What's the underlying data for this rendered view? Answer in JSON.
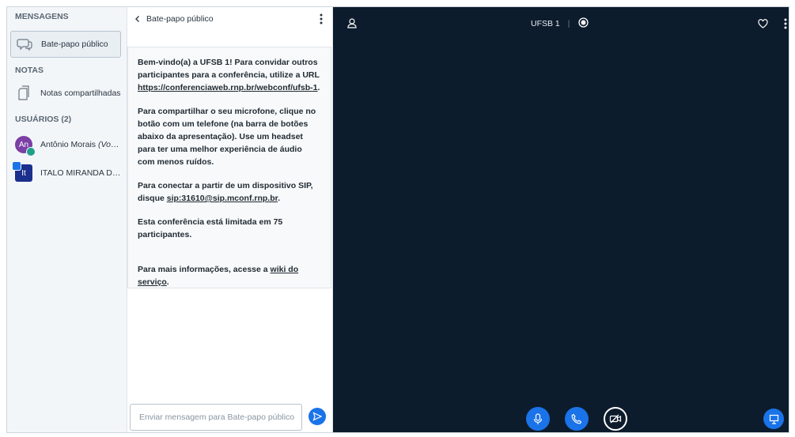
{
  "sidebar": {
    "messages_title": "MENSAGENS",
    "public_chat_label": "Bate-papo público",
    "notes_title": "NOTAS",
    "shared_notes_label": "Notas compartilhadas",
    "users_title": "USUÁRIOS (2)",
    "users": [
      {
        "initials": "An",
        "name": "Antônio Morais",
        "suffix": "(Você)",
        "color": "#7b3fa5"
      },
      {
        "initials": "It",
        "name": "ITALO MIRANDA DE ...",
        "suffix": "",
        "color": "#1b2f8c"
      }
    ]
  },
  "chat": {
    "header_title": "Bate-papo público",
    "welcome": {
      "p1_a": "Bem-vindo(a) a ",
      "p1_conf": "UFSB 1",
      "p1_b": "! Para convidar outros participantes para a conferência, utilize a URL ",
      "p1_url": "https://conferenciaweb.rnp.br/webconf/ufsb-1",
      "p1_end": ".",
      "p2": "Para compartilhar o seu microfone, clique no botão com um telefone (na barra de botões abaixo da apresentação). Use um headset para ter uma melhor experiência de áudio com menos ruídos.",
      "p3_a": "Para conectar a partir de um dispositivo SIP, disque ",
      "p3_sip": "sip:31610@sip.mconf.rnp.br",
      "p3_end": ".",
      "p4": "Esta conferência está limitada em 75 participantes.",
      "p5_a": "Para mais informações, acesse a ",
      "p5_link": "wiki do serviço",
      "p5_end": "."
    },
    "input_placeholder": "Enviar mensagem para Bate-papo público"
  },
  "stage": {
    "conference_name": "UFSB 1",
    "separator": "|"
  },
  "colors": {
    "accent": "#1a73e8",
    "stage_bg": "#0d1c2c"
  }
}
